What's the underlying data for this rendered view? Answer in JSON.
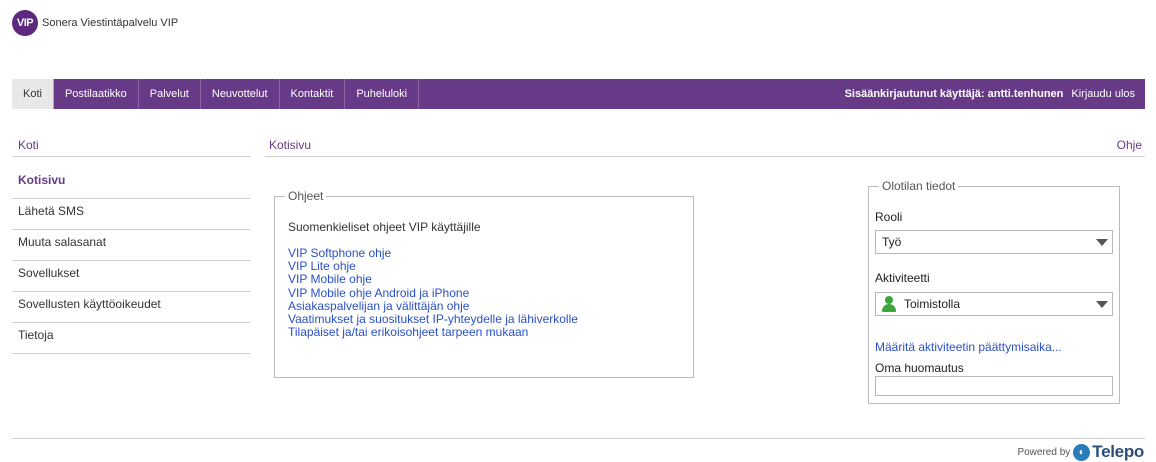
{
  "header": {
    "logo_badge": "VIP",
    "app_title": "Sonera Viestintäpalvelu VIP"
  },
  "nav": {
    "tabs": [
      {
        "label": "Koti",
        "active": true
      },
      {
        "label": "Postilaatikko"
      },
      {
        "label": "Palvelut"
      },
      {
        "label": "Neuvottelut"
      },
      {
        "label": "Kontaktit"
      },
      {
        "label": "Puheluloki"
      }
    ],
    "user_text": "Sisäänkirjautunut käyttäjä: antti.tenhunen",
    "logout_label": "Kirjaudu ulos"
  },
  "sidebar": {
    "title": "Koti",
    "items": [
      {
        "label": "Kotisivu",
        "active": true
      },
      {
        "label": "Lähetä SMS"
      },
      {
        "label": "Muuta salasanat"
      },
      {
        "label": "Sovellukset"
      },
      {
        "label": "Sovellusten käyttöoikeudet"
      },
      {
        "label": "Tietoja"
      }
    ]
  },
  "main": {
    "breadcrumb": "Kotisivu",
    "help_label": "Ohje",
    "instructions": {
      "legend": "Ohjeet",
      "intro": "Suomenkieliset ohjeet VIP käyttäjille",
      "links": [
        "VIP Softphone ohje",
        "VIP Lite ohje",
        "VIP Mobile ohje",
        "VIP Mobile ohje Android ja iPhone",
        "Asiakaspalvelijan ja välittäjän ohje",
        "Vaatimukset ja suositukset IP-yhteydelle ja lähiverkolle",
        "Tilapäiset ja/tai erikoisohjeet tarpeen mukaan"
      ]
    },
    "presence": {
      "legend": "Olotilan tiedot",
      "role_label": "Rooli",
      "role_value": "Työ",
      "activity_label": "Aktiviteetti",
      "activity_value": "Toimistolla",
      "activity_color": "#3aa63a",
      "set_end_link": "Määritä aktiviteetin päättymisaika...",
      "note_label": "Oma huomautus",
      "note_value": ""
    }
  },
  "footer": {
    "powered_by": "Powered by",
    "brand": "Telepo"
  },
  "colors": {
    "brand_purple": "#663a86",
    "link_blue": "#2a50c8"
  }
}
